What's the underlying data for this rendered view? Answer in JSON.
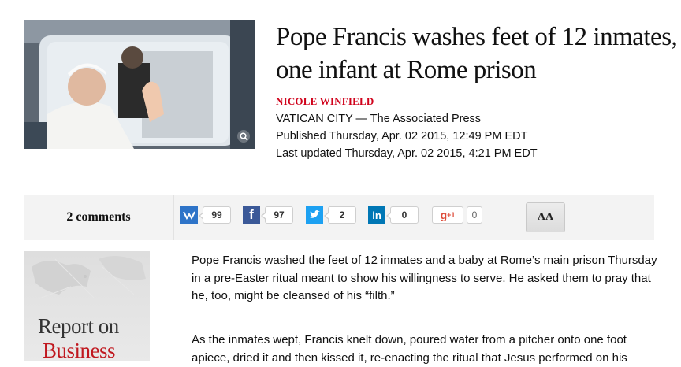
{
  "article": {
    "headline": "Pope Francis washes feet of 12 inmates, one infant at Rome prison",
    "byline": "NICOLE WINFIELD",
    "dateline": "VATICAN CITY — The Associated Press",
    "published": "Published Thursday, Apr. 02 2015, 12:49 PM EDT",
    "updated": "Last updated Thursday, Apr. 02 2015, 4:21 PM EDT",
    "paragraphs": [
      "Pope Francis washed the feet of 12 inmates and a baby at Rome’s main prison Thursday in a pre-Easter ritual meant to show his willingness to serve. He asked them to pray that he, too, might be cleansed of his “filth.”",
      "As the inmates wept, Francis knelt down, poured water from a pitcher onto one foot apiece, dried it and then kissed it, re-enacting the ritual that Jesus performed on his"
    ]
  },
  "hero_image": {
    "zoom_icon": "magnifier-icon"
  },
  "share_bar": {
    "comments_label": "2 comments",
    "items": [
      {
        "network": "vk-icon",
        "count": "99",
        "color": "#2e74c8"
      },
      {
        "network": "facebook-icon",
        "count": "97",
        "color": "#3b5998"
      },
      {
        "network": "twitter-icon",
        "count": "2",
        "color": "#1da1f2"
      },
      {
        "network": "linkedin-icon",
        "count": "0",
        "color": "#0077b5"
      }
    ],
    "gplus": {
      "label": "g",
      "sup": "+1",
      "count": "0",
      "color": "#dd4b39"
    },
    "font_size_label": "AA"
  },
  "promo": {
    "line1": "Report on",
    "line2": "Business"
  },
  "colors": {
    "byline": "#d0021b",
    "bar_background": "#f3f3f3"
  }
}
